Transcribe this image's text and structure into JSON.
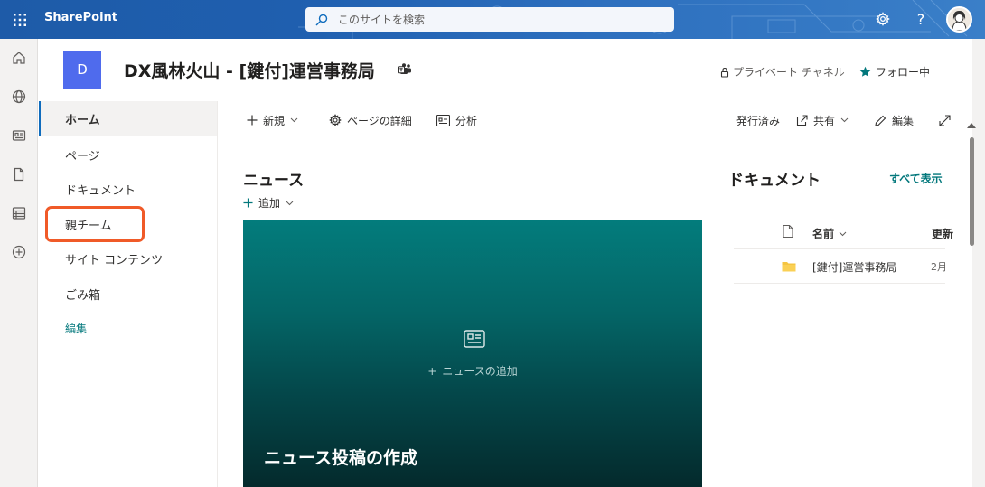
{
  "suite": {
    "brand": "SharePoint",
    "search_placeholder": "このサイトを検索"
  },
  "site": {
    "logo_letter": "D",
    "title": "DX風林火山 - [鍵付]運営事務局",
    "privacy": "プライベート チャネル",
    "follow": "フォロー中"
  },
  "nav": {
    "items": [
      {
        "label": "ホーム"
      },
      {
        "label": "ページ"
      },
      {
        "label": "ドキュメント"
      },
      {
        "label": "親チーム"
      },
      {
        "label": "サイト コンテンツ"
      },
      {
        "label": "ごみ箱"
      }
    ],
    "edit": "編集"
  },
  "commandbar": {
    "new": "新規",
    "page_details": "ページの詳細",
    "analytics": "分析",
    "published": "発行済み",
    "share": "共有",
    "edit": "編集"
  },
  "news": {
    "title": "ニュース",
    "add": "追加",
    "add_news": "ニュースの追加",
    "create_post": "ニュース投稿の作成"
  },
  "documents": {
    "title": "ドキュメント",
    "see_all": "すべて表示",
    "col_name": "名前",
    "col_modified": "更新",
    "rows": [
      {
        "name": "[鍵付]運営事務局",
        "modified": "2月"
      }
    ]
  },
  "colors": {
    "suite_bar": "#1f5faf",
    "accent": "#03787c",
    "site_logo": "#4f6bed",
    "highlight": "#f05a28"
  }
}
